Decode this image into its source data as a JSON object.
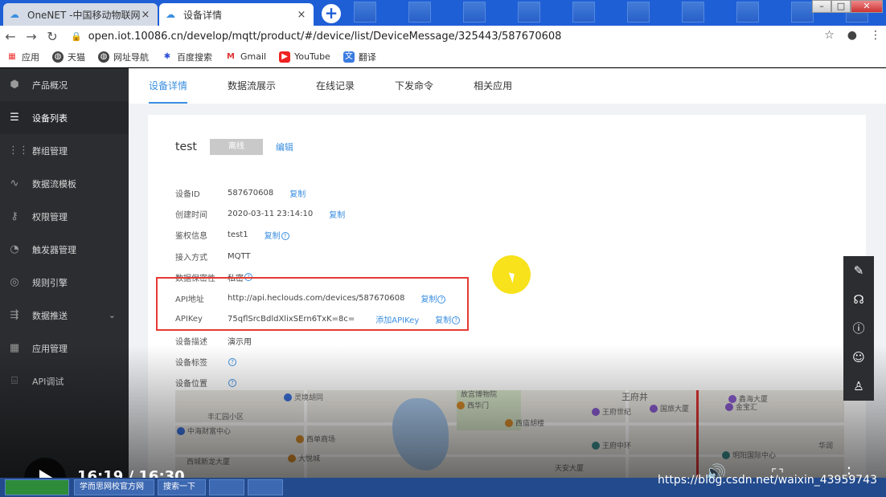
{
  "browser": {
    "tabs": [
      {
        "title": "OneNET -中国移动物联网开放平",
        "close": "×"
      },
      {
        "title": "设备详情",
        "close": "×"
      }
    ],
    "new_tab": "+",
    "url": "open.iot.10086.cn/develop/mqtt/product/#/device/list/DeviceMessage/325443/587670608",
    "bookmarks": [
      "应用",
      "天猫",
      "网址导航",
      "百度搜索",
      "Gmail",
      "YouTube",
      "翻译"
    ]
  },
  "sidebar": {
    "items": [
      {
        "label": "产品概况",
        "icon": "cube-icon"
      },
      {
        "label": "设备列表",
        "icon": "list-icon"
      },
      {
        "label": "群组管理",
        "icon": "grid-icon"
      },
      {
        "label": "数据流模板",
        "icon": "stream-icon"
      },
      {
        "label": "权限管理",
        "icon": "key-icon"
      },
      {
        "label": "触发器管理",
        "icon": "trigger-icon"
      },
      {
        "label": "规则引擎",
        "icon": "rule-icon"
      },
      {
        "label": "数据推送",
        "icon": "push-icon"
      },
      {
        "label": "应用管理",
        "icon": "apps-icon"
      },
      {
        "label": "API调试",
        "icon": "api-icon"
      }
    ]
  },
  "topnav": {
    "tabs": [
      "设备详情",
      "数据流展示",
      "在线记录",
      "下发命令",
      "相关应用"
    ]
  },
  "device": {
    "name": "test",
    "status": "离线",
    "edit": "编辑",
    "rows": {
      "id": {
        "label": "设备ID",
        "value": "587670608",
        "action": "复制"
      },
      "created": {
        "label": "创建时间",
        "value": "2020-03-11 23:14:10",
        "action": "复制"
      },
      "auth": {
        "label": "鉴权信息",
        "value": "test1",
        "action": "复制"
      },
      "protocol": {
        "label": "接入方式",
        "value": "MQTT"
      },
      "privacy": {
        "label": "数据保密性",
        "value": "私密"
      },
      "api_url": {
        "label": "API地址",
        "value": "http://api.heclouds.com/devices/587670608",
        "action": "复制"
      },
      "apikey": {
        "label": "APIKey",
        "value": "75qflSrcBdldXlixSErn6TxK=8c=",
        "add": "添加APIKey",
        "action": "复制"
      },
      "desc": {
        "label": "设备描述",
        "value": "演示用"
      },
      "tags": {
        "label": "设备标签"
      },
      "location": {
        "label": "设备位置"
      }
    }
  },
  "map": {
    "labels": [
      "灵境胡同",
      "故宫博物院",
      "王府井",
      "鑫海大厦",
      "西华门",
      "王府世纪",
      "国旅大厦",
      "金宝汇",
      "丰汇园小区",
      "西单商场",
      "西庙胡楼",
      "王府中环",
      "中海财富中心",
      "大悦城",
      "西城新龙大厦",
      "天安大厦",
      "明阳国际中心",
      "华润"
    ]
  },
  "video": {
    "time": "16:19 / 16:30",
    "watermark": "https://blog.csdn.net/waixin_43959743"
  },
  "taskbar": {
    "items": [
      "学而思网校官方网",
      "搜索一下"
    ]
  }
}
